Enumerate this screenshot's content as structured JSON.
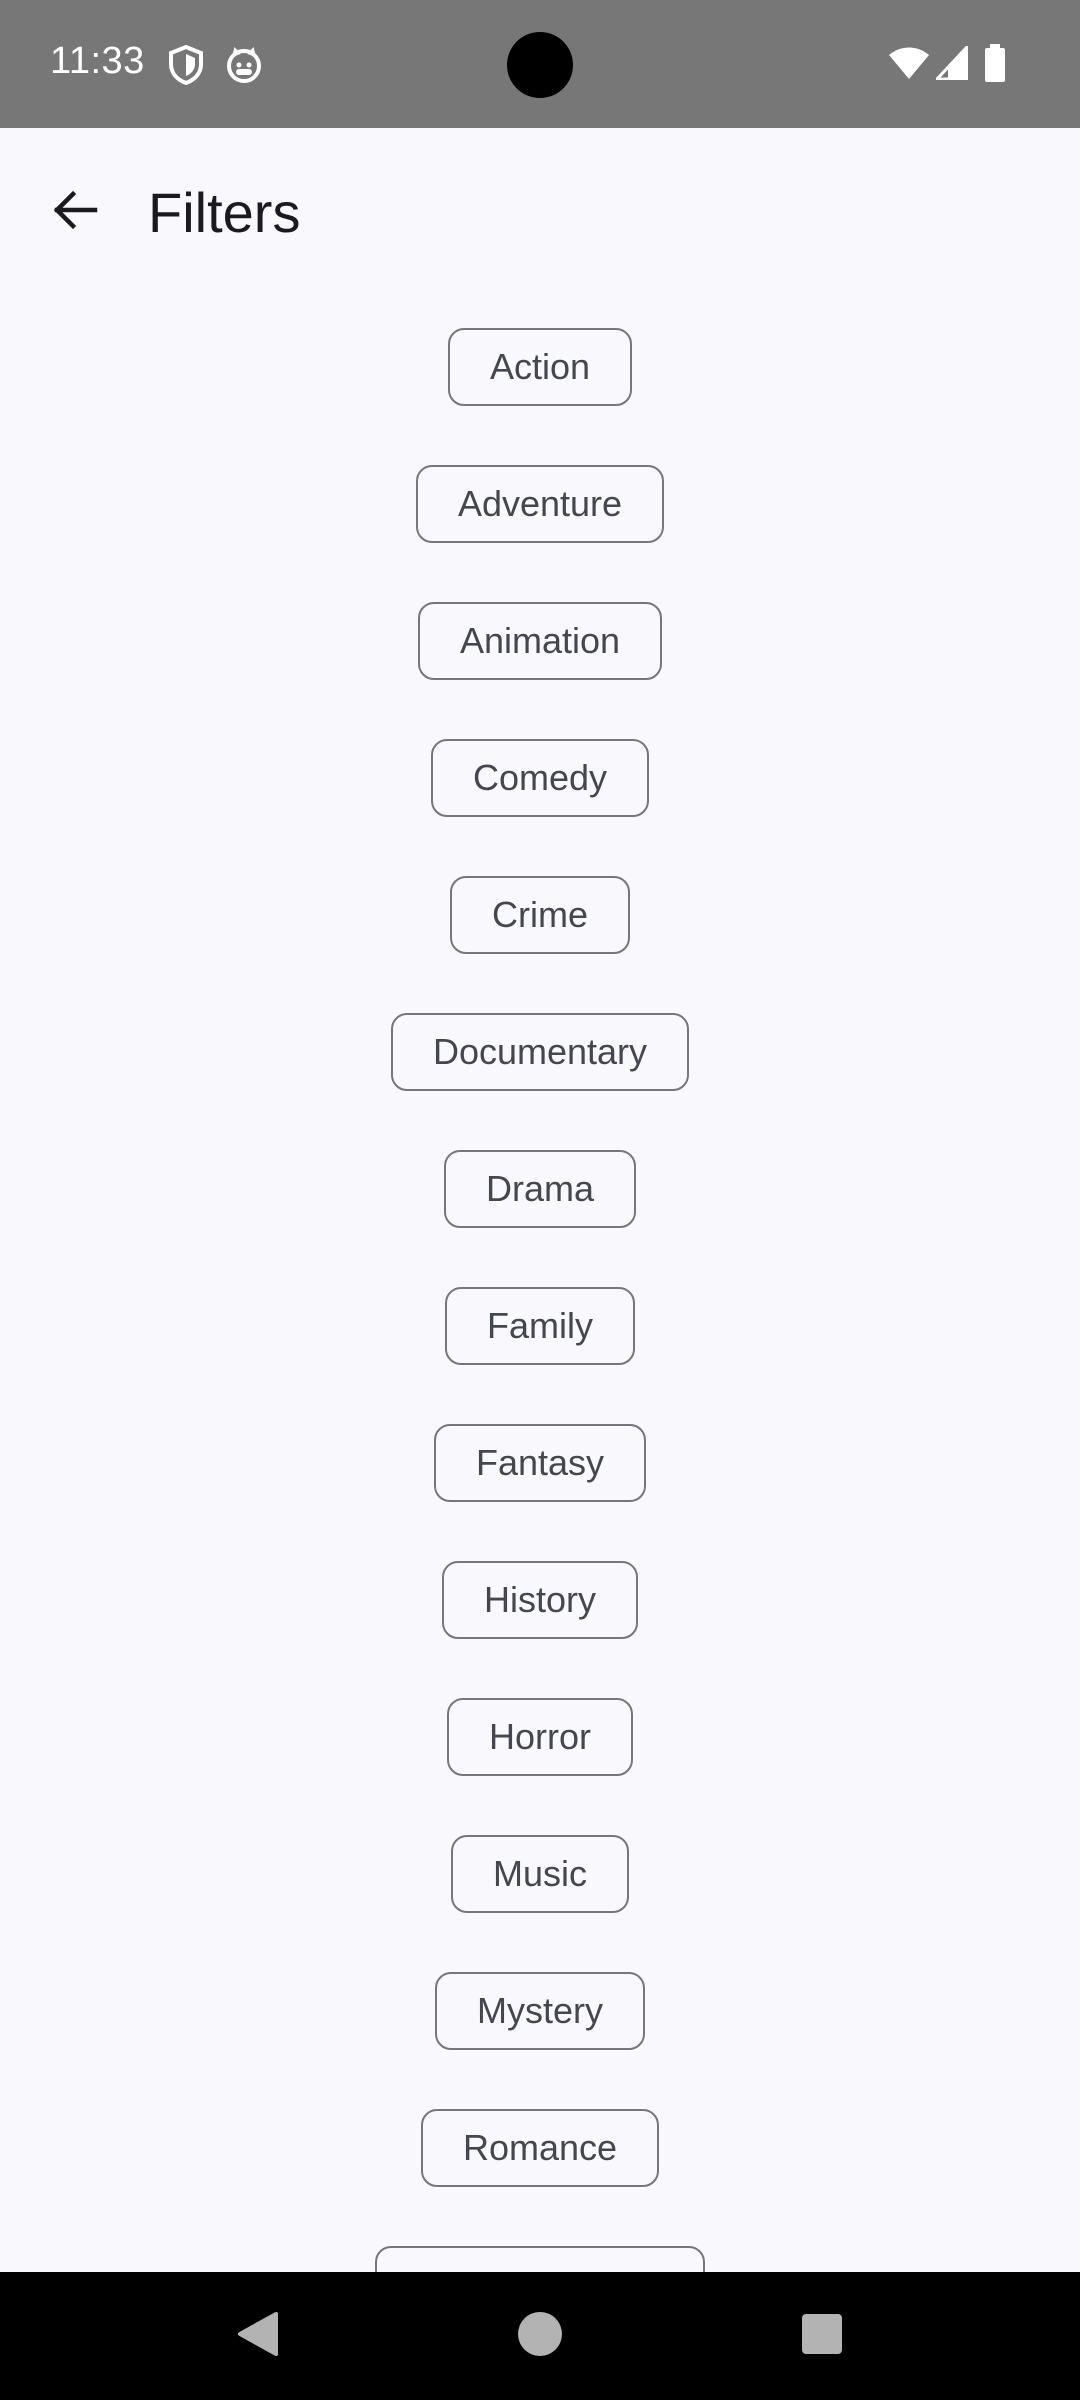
{
  "status_bar": {
    "time": "11:33",
    "icons_left": [
      "shield-icon",
      "cat-face-icon"
    ],
    "icons_right": [
      "wifi-icon",
      "cell-signal-icon",
      "battery-icon"
    ]
  },
  "app_bar": {
    "title": "Filters",
    "back_icon": "arrow-back-icon"
  },
  "filters": [
    {
      "label": "Action"
    },
    {
      "label": "Adventure"
    },
    {
      "label": "Animation"
    },
    {
      "label": "Comedy"
    },
    {
      "label": "Crime"
    },
    {
      "label": "Documentary"
    },
    {
      "label": "Drama"
    },
    {
      "label": "Family"
    },
    {
      "label": "Fantasy"
    },
    {
      "label": "History"
    },
    {
      "label": "Horror"
    },
    {
      "label": "Music"
    },
    {
      "label": "Mystery"
    },
    {
      "label": "Romance"
    },
    {
      "label": ""
    }
  ],
  "nav_bar": {
    "buttons": [
      "back-triangle-icon",
      "home-circle-icon",
      "recents-square-icon"
    ]
  },
  "colors": {
    "status_bar": "#777777",
    "background": "#f8f8fd",
    "chip_border": "#74777f",
    "chip_text": "#44474f",
    "title_text": "#1b1b1f",
    "nav_bar": "#000000",
    "nav_icon": "#b3b3b3"
  }
}
